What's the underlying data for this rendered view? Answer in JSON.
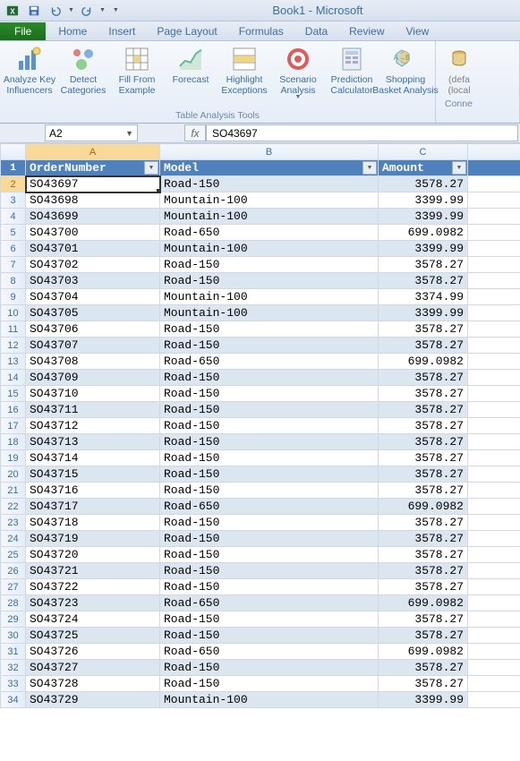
{
  "window": {
    "title": "Book1 - Microsoft"
  },
  "tabs": [
    "File",
    "Home",
    "Insert",
    "Page Layout",
    "Formulas",
    "Data",
    "Review",
    "View"
  ],
  "ribbon": {
    "group_label": "Table Analysis Tools",
    "buttons": [
      {
        "label": "Analyze Key\nInfluencers",
        "arrow": false
      },
      {
        "label": "Detect\nCategories",
        "arrow": false
      },
      {
        "label": "Fill From\nExample",
        "arrow": false
      },
      {
        "label": "Forecast",
        "arrow": false
      },
      {
        "label": "Highlight\nExceptions",
        "arrow": false
      },
      {
        "label": "Scenario\nAnalysis",
        "arrow": true
      },
      {
        "label": "Prediction\nCalculator",
        "arrow": false
      },
      {
        "label": "Shopping\nBasket Analysis",
        "arrow": false
      }
    ],
    "side": {
      "label": "(defa\n(local",
      "sublabel": "Conne"
    }
  },
  "namebox": "A2",
  "formula": "SO43697",
  "columns": [
    "A",
    "B",
    "C"
  ],
  "headers": [
    "OrderNumber",
    "Model",
    "Amount"
  ],
  "rows": [
    {
      "a": "SO43697",
      "b": "Road-150",
      "c": "3578.27"
    },
    {
      "a": "SO43698",
      "b": "Mountain-100",
      "c": "3399.99"
    },
    {
      "a": "SO43699",
      "b": "Mountain-100",
      "c": "3399.99"
    },
    {
      "a": "SO43700",
      "b": "Road-650",
      "c": "699.0982"
    },
    {
      "a": "SO43701",
      "b": "Mountain-100",
      "c": "3399.99"
    },
    {
      "a": "SO43702",
      "b": "Road-150",
      "c": "3578.27"
    },
    {
      "a": "SO43703",
      "b": "Road-150",
      "c": "3578.27"
    },
    {
      "a": "SO43704",
      "b": "Mountain-100",
      "c": "3374.99"
    },
    {
      "a": "SO43705",
      "b": "Mountain-100",
      "c": "3399.99"
    },
    {
      "a": "SO43706",
      "b": "Road-150",
      "c": "3578.27"
    },
    {
      "a": "SO43707",
      "b": "Road-150",
      "c": "3578.27"
    },
    {
      "a": "SO43708",
      "b": "Road-650",
      "c": "699.0982"
    },
    {
      "a": "SO43709",
      "b": "Road-150",
      "c": "3578.27"
    },
    {
      "a": "SO43710",
      "b": "Road-150",
      "c": "3578.27"
    },
    {
      "a": "SO43711",
      "b": "Road-150",
      "c": "3578.27"
    },
    {
      "a": "SO43712",
      "b": "Road-150",
      "c": "3578.27"
    },
    {
      "a": "SO43713",
      "b": "Road-150",
      "c": "3578.27"
    },
    {
      "a": "SO43714",
      "b": "Road-150",
      "c": "3578.27"
    },
    {
      "a": "SO43715",
      "b": "Road-150",
      "c": "3578.27"
    },
    {
      "a": "SO43716",
      "b": "Road-150",
      "c": "3578.27"
    },
    {
      "a": "SO43717",
      "b": "Road-650",
      "c": "699.0982"
    },
    {
      "a": "SO43718",
      "b": "Road-150",
      "c": "3578.27"
    },
    {
      "a": "SO43719",
      "b": "Road-150",
      "c": "3578.27"
    },
    {
      "a": "SO43720",
      "b": "Road-150",
      "c": "3578.27"
    },
    {
      "a": "SO43721",
      "b": "Road-150",
      "c": "3578.27"
    },
    {
      "a": "SO43722",
      "b": "Road-150",
      "c": "3578.27"
    },
    {
      "a": "SO43723",
      "b": "Road-650",
      "c": "699.0982"
    },
    {
      "a": "SO43724",
      "b": "Road-150",
      "c": "3578.27"
    },
    {
      "a": "SO43725",
      "b": "Road-150",
      "c": "3578.27"
    },
    {
      "a": "SO43726",
      "b": "Road-650",
      "c": "699.0982"
    },
    {
      "a": "SO43727",
      "b": "Road-150",
      "c": "3578.27"
    },
    {
      "a": "SO43728",
      "b": "Road-150",
      "c": "3578.27"
    },
    {
      "a": "SO43729",
      "b": "Mountain-100",
      "c": "3399.99"
    }
  ]
}
